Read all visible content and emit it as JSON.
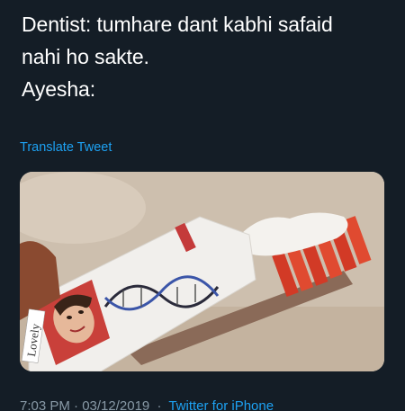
{
  "tweet": {
    "lines": [
      "Dentist: tumhare dant kabhi safaid",
      "nahi ho sakte.",
      "Ayesha:"
    ],
    "translate_label": "Translate Tweet",
    "media": {
      "packet_text": "Lovely",
      "icon": "dna-helix"
    },
    "timestamp": "7:03 PM · 03/12/2019",
    "separator": "·",
    "source": "Twitter for iPhone"
  },
  "colors": {
    "background": "#141d26",
    "text": "#ffffff",
    "link": "#1da1f2",
    "muted": "#8899a6"
  }
}
